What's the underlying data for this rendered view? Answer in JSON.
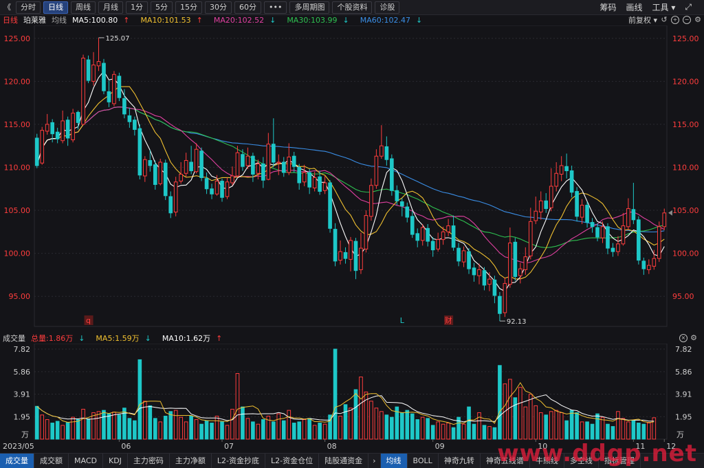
{
  "toolbar": {
    "back_icon": "double-chevron-left-icon",
    "buttons": [
      "分时",
      "日线",
      "周线",
      "月线",
      "1分",
      "5分",
      "15分",
      "30分",
      "60分",
      "•••",
      "多周期图",
      "个股资料",
      "诊股"
    ],
    "active": "日线",
    "right_links": [
      "筹码",
      "画线",
      "工具"
    ],
    "fullscreen_icon": "fullscreen-icon"
  },
  "legend": {
    "period": "日线",
    "stock": "珀莱雅",
    "ma_label": "均线",
    "ma5": "MA5:100.80",
    "ma10": "MA10:101.53",
    "ma20": "MA20:102.52",
    "ma30": "MA30:103.99",
    "ma60": "MA60:102.47",
    "adjust": "前复权",
    "colors": {
      "ma5": "#ffffff",
      "ma10": "#f0c030",
      "ma20": "#e040a0",
      "ma30": "#2ec050",
      "ma60": "#3a8ee6",
      "up": "#ff3d3d",
      "down": "#1ec8c8",
      "axis": "#ff3d3d"
    }
  },
  "price_axis": {
    "ticks": [
      "125.00",
      "120.00",
      "115.00",
      "110.00",
      "105.00",
      "100.00",
      "95.00"
    ],
    "high_label": "125.07",
    "low_label": "92.13",
    "markers": [
      "q",
      "L",
      "财"
    ]
  },
  "month_axis": [
    "2023/05",
    "06",
    "07",
    "08",
    "09",
    "10",
    "11",
    "12"
  ],
  "volume_legend": {
    "title": "成交量",
    "total": "总量:1.86万",
    "ma5": "MA5:1.59万",
    "ma10": "MA10:1.62万"
  },
  "volume_axis": {
    "ticks": [
      "7.82",
      "5.86",
      "3.91",
      "1.95"
    ],
    "unit": "万"
  },
  "bottom_tabs_left": [
    "成交量",
    "成交额",
    "MACD",
    "KDJ",
    "主力密码",
    "主力净额",
    "L2-资金抄底",
    "L2-资金仓位",
    "陆股通资金"
  ],
  "bottom_tabs_right": [
    "均线",
    "BOLL",
    "神奇九转",
    "神奇五线谱",
    "牛熊线",
    "多空线",
    "指标管理"
  ],
  "bottom_active_left": "成交量",
  "bottom_active_right": "均线",
  "watermark": "www.ddgp.net",
  "chart_data": {
    "type": "candlestick",
    "ylim": [
      91.5,
      126.5
    ],
    "note_months": [
      "2023/05",
      "06",
      "07",
      "08",
      "09",
      "10",
      "11",
      "12"
    ],
    "candles": [
      [
        113.4,
        110.2,
        113.9,
        109.9
      ],
      [
        110.5,
        114.3,
        114.7,
        110.3
      ],
      [
        114.2,
        115.0,
        116.2,
        113.8
      ],
      [
        115.2,
        113.9,
        115.6,
        112.9
      ],
      [
        114.1,
        113.3,
        114.6,
        112.8
      ],
      [
        113.1,
        115.4,
        116.6,
        112.8
      ],
      [
        115.5,
        113.4,
        115.9,
        112.5
      ],
      [
        113.2,
        116.3,
        116.8,
        112.9
      ],
      [
        116.4,
        115.2,
        116.6,
        114.4
      ],
      [
        115.0,
        122.7,
        123.1,
        114.9
      ],
      [
        122.5,
        120.1,
        123.0,
        119.8
      ],
      [
        120.0,
        121.9,
        123.4,
        119.5
      ],
      [
        121.8,
        122.3,
        125.07,
        121.2
      ],
      [
        122.1,
        118.9,
        122.6,
        118.5
      ],
      [
        118.8,
        117.6,
        120.1,
        117.0
      ],
      [
        117.4,
        120.8,
        121.2,
        117.1
      ],
      [
        120.6,
        118.1,
        121.0,
        117.7
      ],
      [
        118.0,
        116.2,
        119.1,
        115.7
      ],
      [
        116.0,
        115.3,
        116.9,
        114.6
      ],
      [
        115.5,
        114.4,
        115.9,
        113.7
      ],
      [
        114.5,
        109.1,
        115.0,
        108.6
      ],
      [
        109.0,
        110.9,
        111.3,
        108.3
      ],
      [
        110.8,
        110.2,
        112.0,
        109.5
      ],
      [
        110.3,
        108.0,
        110.8,
        107.4
      ],
      [
        108.1,
        110.6,
        111.0,
        107.9
      ],
      [
        110.5,
        106.7,
        110.9,
        106.2
      ],
      [
        106.6,
        104.7,
        107.2,
        104.1
      ],
      [
        104.8,
        108.3,
        108.9,
        104.3
      ],
      [
        108.4,
        109.2,
        110.6,
        108.1
      ],
      [
        109.3,
        110.8,
        111.7,
        108.9
      ],
      [
        110.6,
        109.6,
        112.5,
        109.2
      ],
      [
        109.5,
        112.1,
        112.8,
        109.3
      ],
      [
        111.9,
        108.8,
        112.3,
        108.4
      ],
      [
        108.7,
        107.5,
        109.4,
        106.9
      ],
      [
        107.5,
        106.9,
        108.1,
        106.3
      ],
      [
        106.9,
        108.4,
        109.1,
        106.7
      ],
      [
        108.4,
        106.5,
        108.7,
        106.0
      ],
      [
        106.6,
        108.3,
        108.8,
        106.3
      ],
      [
        108.2,
        109.0,
        110.1,
        107.9
      ],
      [
        109.0,
        111.7,
        112.5,
        108.8
      ],
      [
        111.5,
        110.1,
        112.1,
        109.6
      ],
      [
        110.2,
        111.3,
        112.3,
        109.8
      ],
      [
        111.3,
        109.2,
        111.7,
        108.3
      ],
      [
        109.3,
        110.4,
        110.9,
        108.6
      ],
      [
        110.4,
        108.5,
        111.2,
        107.6
      ],
      [
        108.6,
        112.7,
        114.0,
        108.5
      ],
      [
        112.7,
        110.6,
        115.7,
        110.0
      ],
      [
        110.5,
        110.6,
        111.5,
        109.1
      ],
      [
        110.6,
        109.4,
        111.2,
        108.9
      ],
      [
        109.4,
        111.2,
        112.8,
        109.1
      ],
      [
        111.3,
        110.1,
        111.8,
        109.4
      ],
      [
        110.0,
        108.2,
        110.4,
        107.4
      ],
      [
        108.3,
        109.4,
        110.3,
        107.8
      ],
      [
        109.4,
        107.7,
        109.8,
        106.9
      ],
      [
        107.6,
        108.8,
        109.5,
        107.2
      ],
      [
        108.9,
        107.2,
        109.6,
        106.8
      ],
      [
        107.3,
        108.2,
        109.0,
        106.9
      ],
      [
        108.2,
        102.9,
        108.5,
        102.4
      ],
      [
        102.8,
        99.1,
        103.5,
        98.5
      ],
      [
        99.2,
        100.2,
        101.5,
        98.7
      ],
      [
        100.1,
        99.4,
        100.7,
        98.8
      ],
      [
        99.3,
        101.5,
        101.9,
        97.9
      ],
      [
        101.4,
        98.0,
        101.8,
        97.0
      ],
      [
        98.1,
        100.6,
        102.4,
        97.6
      ],
      [
        100.5,
        104.4,
        105.0,
        100.1
      ],
      [
        104.3,
        107.9,
        108.7,
        103.8
      ],
      [
        107.9,
        111.3,
        112.1,
        107.5
      ],
      [
        111.3,
        112.5,
        114.9,
        111.0
      ],
      [
        112.4,
        110.9,
        113.6,
        110.2
      ],
      [
        111.0,
        107.3,
        111.5,
        106.7
      ],
      [
        107.3,
        106.1,
        107.9,
        105.6
      ],
      [
        106.0,
        105.5,
        106.4,
        104.3
      ],
      [
        105.4,
        104.2,
        105.9,
        103.6
      ],
      [
        104.3,
        102.2,
        104.9,
        101.8
      ],
      [
        102.3,
        101.5,
        102.9,
        100.7
      ],
      [
        101.5,
        103.0,
        103.4,
        100.9
      ],
      [
        102.9,
        101.4,
        103.4,
        100.8
      ],
      [
        101.4,
        100.4,
        101.9,
        99.6
      ],
      [
        100.5,
        101.6,
        102.4,
        100.2
      ],
      [
        101.6,
        102.5,
        103.1,
        101.0
      ],
      [
        102.5,
        103.2,
        104.0,
        102.0
      ],
      [
        103.2,
        100.7,
        104.4,
        100.3
      ],
      [
        100.6,
        99.1,
        101.2,
        98.5
      ],
      [
        99.0,
        100.3,
        100.8,
        98.4
      ],
      [
        100.2,
        98.2,
        100.6,
        97.6
      ],
      [
        98.3,
        97.5,
        98.9,
        96.7
      ],
      [
        97.4,
        98.1,
        98.8,
        96.4
      ],
      [
        98.0,
        96.3,
        98.4,
        95.7
      ],
      [
        96.4,
        97.0,
        97.8,
        95.6
      ],
      [
        96.9,
        95.1,
        97.4,
        94.2
      ],
      [
        95.0,
        93.0,
        95.5,
        92.13
      ],
      [
        93.1,
        96.5,
        97.2,
        92.6
      ],
      [
        96.4,
        101.2,
        103.0,
        96.0
      ],
      [
        101.3,
        97.3,
        101.8,
        96.8
      ],
      [
        97.4,
        98.2,
        98.9,
        96.5
      ],
      [
        98.1,
        99.6,
        100.7,
        97.5
      ],
      [
        99.7,
        103.7,
        105.3,
        99.3
      ],
      [
        103.8,
        104.9,
        106.6,
        103.4
      ],
      [
        104.8,
        106.1,
        107.2,
        103.9
      ],
      [
        106.1,
        105.2,
        107.0,
        104.7
      ],
      [
        105.3,
        107.8,
        109.9,
        104.9
      ],
      [
        107.8,
        109.3,
        110.6,
        107.2
      ],
      [
        109.2,
        110.2,
        111.3,
        108.4
      ],
      [
        110.1,
        109.6,
        111.6,
        108.7
      ],
      [
        109.6,
        107.1,
        110.2,
        106.5
      ],
      [
        107.2,
        104.3,
        107.7,
        103.7
      ],
      [
        104.2,
        105.6,
        106.3,
        103.4
      ],
      [
        105.6,
        103.6,
        106.0,
        103.0
      ],
      [
        103.6,
        103.1,
        104.1,
        102.4
      ],
      [
        103.0,
        101.9,
        103.5,
        101.4
      ],
      [
        101.8,
        103.1,
        103.7,
        101.2
      ],
      [
        103.1,
        100.6,
        103.5,
        99.9
      ],
      [
        100.6,
        100.2,
        101.2,
        99.6
      ],
      [
        100.2,
        101.1,
        102.0,
        99.7
      ],
      [
        101.1,
        103.2,
        104.7,
        100.9
      ],
      [
        103.1,
        105.2,
        106.4,
        102.7
      ],
      [
        105.1,
        103.9,
        108.2,
        103.4
      ],
      [
        103.9,
        99.2,
        104.3,
        98.7
      ],
      [
        99.1,
        98.2,
        99.5,
        97.5
      ],
      [
        98.1,
        98.6,
        99.3,
        97.6
      ],
      [
        98.5,
        99.4,
        100.4,
        98.1
      ],
      [
        99.4,
        103.1,
        103.7,
        99.0
      ],
      [
        103.1,
        104.7,
        105.2,
        102.7
      ]
    ],
    "volume": [
      2.85,
      2.1,
      1.7,
      1.4,
      1.55,
      1.2,
      1.45,
      1.9,
      1.7,
      2.6,
      1.75,
      2.3,
      2.4,
      2.5,
      2.2,
      2.35,
      2.1,
      2.7,
      1.8,
      1.6,
      6.9,
      3.3,
      2.9,
      1.8,
      1.5,
      2.0,
      2.4,
      2.5,
      1.9,
      1.5,
      2.0,
      1.7,
      1.3,
      1.6,
      1.4,
      2.0,
      1.5,
      1.2,
      2.6,
      5.7,
      2.8,
      1.8,
      1.5,
      1.3,
      1.7,
      2.0,
      1.5,
      2.2,
      1.6,
      2.5,
      1.4,
      1.5,
      1.7,
      1.8,
      1.2,
      1.4,
      1.3,
      2.1,
      7.82,
      2.0,
      3.0,
      2.7,
      4.3,
      5.4,
      4.1,
      3.3,
      2.7,
      2.4,
      2.1,
      1.9,
      2.8,
      2.3,
      2.5,
      2.2,
      1.7,
      1.9,
      1.8,
      1.2,
      1.5,
      1.3,
      1.4,
      1.0,
      1.9,
      1.3,
      2.8,
      1.3,
      2.3,
      1.2,
      1.1,
      1.0,
      6.4,
      4.8,
      5.2,
      3.6,
      4.5,
      2.8,
      3.9,
      2.9,
      2.3,
      2.1,
      2.4,
      2.5,
      2.3,
      1.6,
      2.5,
      2.3,
      1.5,
      1.5,
      1.3,
      2.2,
      1.9,
      1.3,
      1.1,
      2.4,
      1.8,
      1.5,
      1.6,
      1.4,
      1.3,
      1.4,
      1.86
    ]
  }
}
